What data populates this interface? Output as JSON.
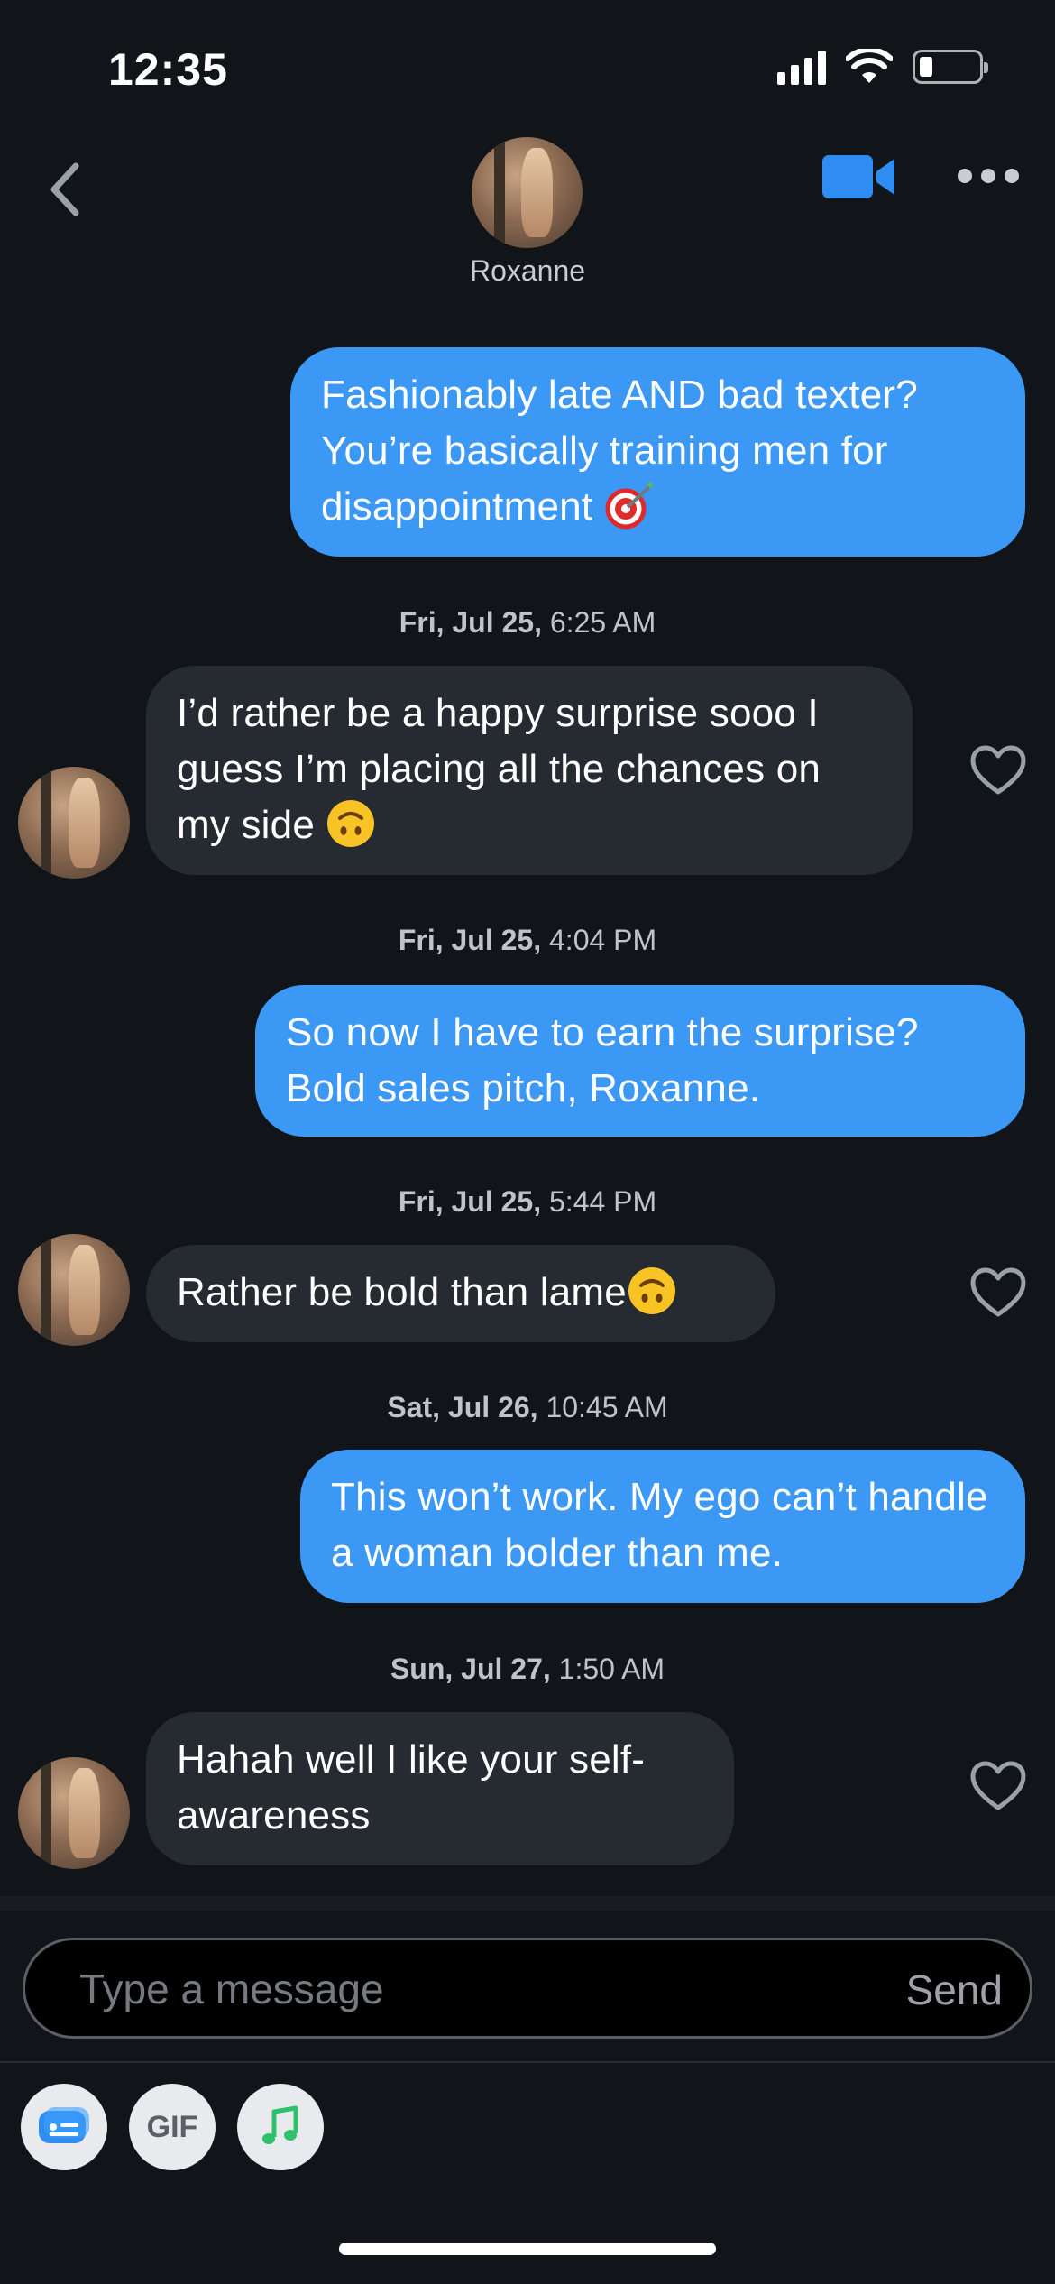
{
  "status_bar": {
    "time": "12:35"
  },
  "header": {
    "contact_name": "Roxanne"
  },
  "messages": [
    {
      "dir": "out",
      "text": "Fashionably late AND bad texter? You’re basically training men for disappointment",
      "emoji": "direct-hit"
    },
    {
      "type": "timestamp",
      "date": "Fri, Jul 25,",
      "time": "6:25 AM"
    },
    {
      "dir": "in",
      "text": "I’d rather be a happy surprise sooo I guess I’m placing all the chances on my side",
      "emoji": "upside-down-face"
    },
    {
      "type": "timestamp",
      "date": "Fri, Jul 25,",
      "time": "4:04 PM"
    },
    {
      "dir": "out",
      "text": "So now I have to earn the surprise? Bold sales pitch, Roxanne."
    },
    {
      "type": "timestamp",
      "date": "Fri, Jul 25,",
      "time": "5:44 PM"
    },
    {
      "dir": "in",
      "text": "Rather be bold than lame",
      "emoji": "upside-down-face"
    },
    {
      "type": "timestamp",
      "date": "Sat, Jul 26,",
      "time": "10:45 AM"
    },
    {
      "dir": "out",
      "text": "This won’t work. My ego can’t handle a woman bolder than me."
    },
    {
      "type": "timestamp",
      "date": "Sun, Jul 27,",
      "time": "1:50 AM"
    },
    {
      "dir": "in",
      "text": "Hahah well I like your self-awareness"
    }
  ],
  "composer": {
    "placeholder": "Type a message",
    "send_label": "Send"
  },
  "toolbar": {
    "gif_label": "GIF"
  },
  "colors": {
    "outgoing_bubble": "#3b98f5",
    "incoming_bubble": "#262a31",
    "background": "#111418",
    "accent": "#2f8cf0"
  }
}
